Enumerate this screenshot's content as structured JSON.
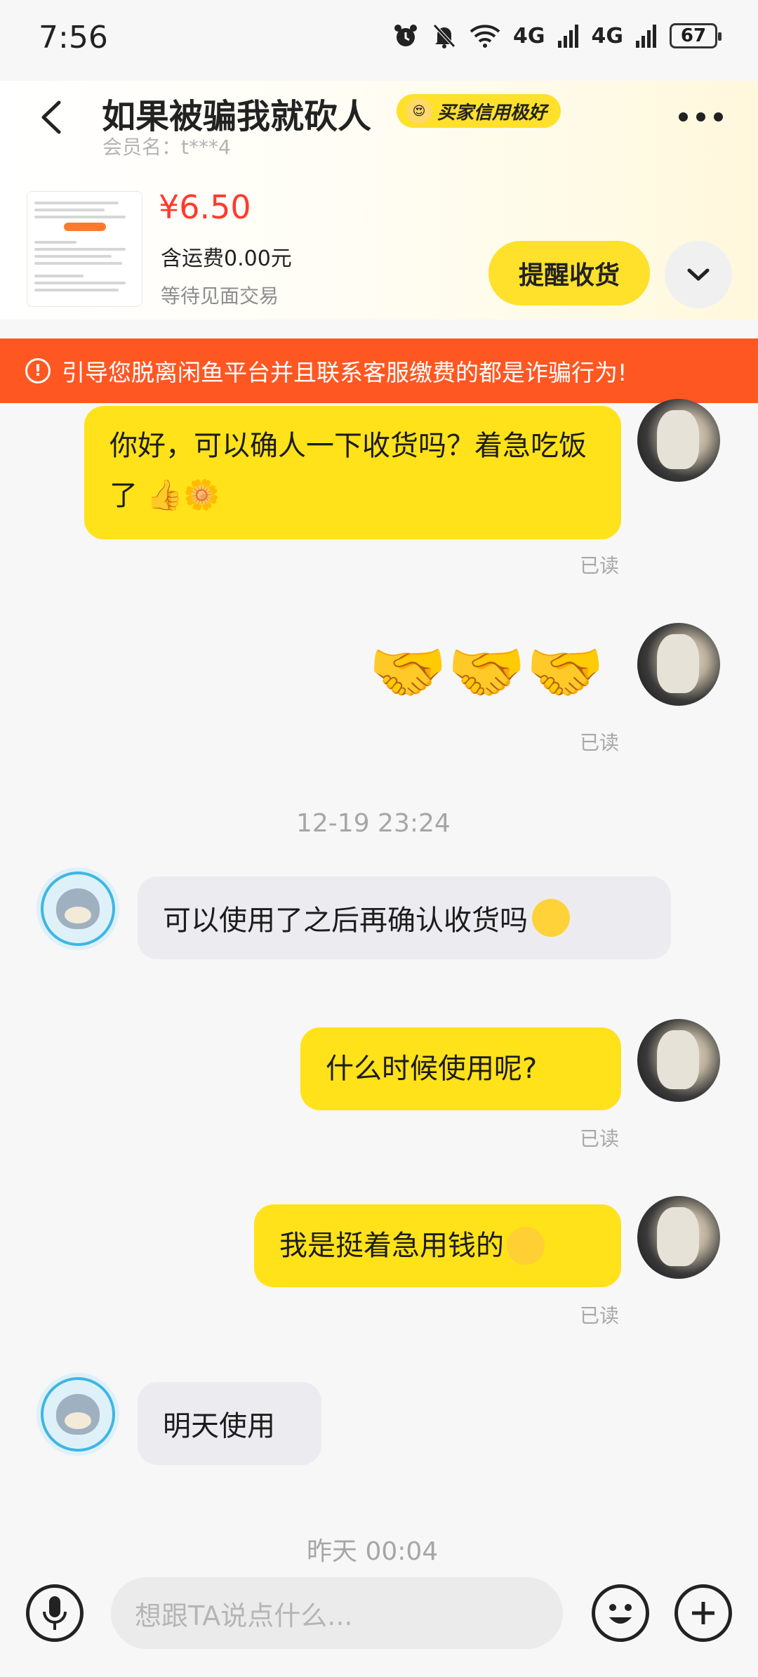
{
  "status_bar": {
    "time": "7:56",
    "signal1": "4G",
    "signal2": "4G",
    "battery": "67"
  },
  "header": {
    "title": "如果被骗我就砍人",
    "badge": "买家信用极好",
    "member": "会员名：t***4"
  },
  "order": {
    "price": "¥6.50",
    "shipping": "含运费0.00元",
    "status": "等待见面交易",
    "remind_button": "提醒收货"
  },
  "warning": {
    "text": "引导您脱离闲鱼平台并且联系客服缴费的都是诈骗行为!"
  },
  "messages": {
    "m1": {
      "text": "你好，可以确人一下收货吗？着急吃饭了",
      "read": "已读"
    },
    "m2": {
      "emoji": "🤝🤝🤝",
      "read": "已读"
    },
    "ts1": "12-19 23:24",
    "m3": {
      "text": "可以使用了之后再确认收货吗"
    },
    "m4": {
      "text": "什么时候使用呢?",
      "read": "已读"
    },
    "m5": {
      "text": "我是挺着急用钱的",
      "read": "已读"
    },
    "m6": {
      "text": "明天使用"
    },
    "ts2": "昨天 00:04"
  },
  "input": {
    "placeholder": "想跟TA说点什么..."
  },
  "icons": {
    "back": "back-arrow-icon",
    "more": "more-dots-icon",
    "chevron": "chevron-down-icon",
    "warning": "warning-icon",
    "mic": "mic-icon",
    "emoji": "emoji-icon",
    "plus": "plus-icon"
  },
  "colors": {
    "accent_yellow": "#ffe21a",
    "warning_orange": "#ff5722",
    "price_red": "#ff3a2e"
  }
}
